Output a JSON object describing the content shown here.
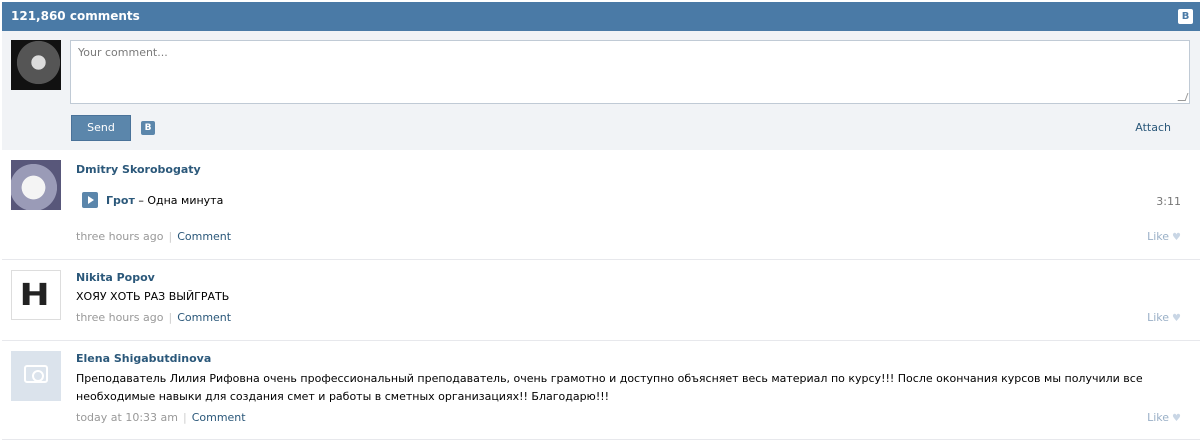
{
  "header": {
    "title": "121,860 comments",
    "badge": "B"
  },
  "compose": {
    "placeholder": "Your comment...",
    "send_label": "Send",
    "badge": "B",
    "attach_label": "Attach"
  },
  "comments": [
    {
      "author": "Dmitry Skorobogaty",
      "audio": {
        "artist": "Грот",
        "separator": " – ",
        "title": "Одна минута",
        "duration": "3:11"
      },
      "time": "three hours ago",
      "comment_label": "Comment",
      "like_label": "Like"
    },
    {
      "author": "Nikita Popov",
      "avatar_text": "H",
      "text": "ХОЯУ ХОТЬ РАЗ ВЫЙГРАТЬ",
      "time": "three hours ago",
      "comment_label": "Comment",
      "like_label": "Like"
    },
    {
      "author": "Elena Shigabutdinova",
      "text_line1": "Преподаватель Лилия Рифовна очень профессиональный преподаватель, очень грамотно и доступно объясняет весь материал по курсу!!! После окончания курсов мы получили все",
      "text_line2": "необходимые навыки для создания смет и работы в сметных организациях!! Благодарю!!!",
      "time": "today at 10:33 am",
      "comment_label": "Comment",
      "like_label": "Like"
    }
  ]
}
